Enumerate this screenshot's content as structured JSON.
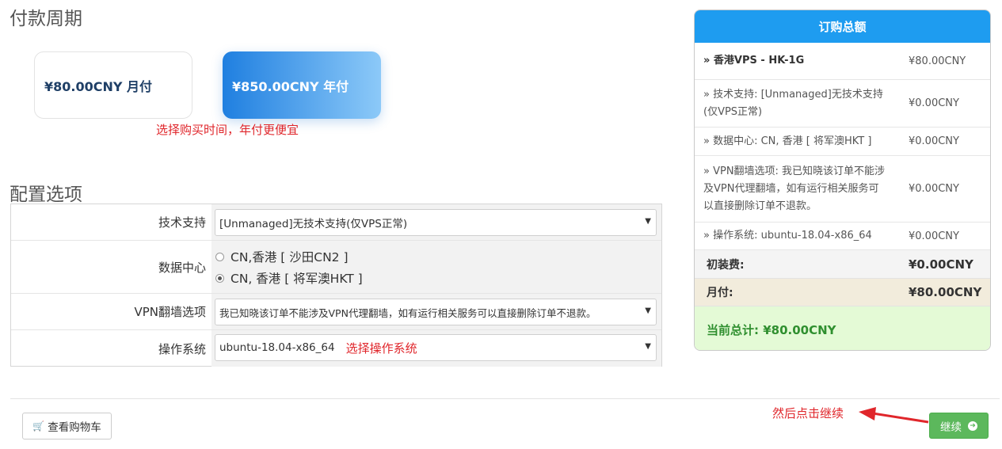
{
  "billing": {
    "title": "付款周期",
    "monthly_label": "¥80.00CNY 月付",
    "annual_label": "¥850.00CNY 年付",
    "annotation": "选择购买时间，年付更便宜"
  },
  "config": {
    "title": "配置选项",
    "support": {
      "label": "技术支持",
      "value": "[Unmanaged]无技术支持(仅VPS正常)"
    },
    "datacenter": {
      "label": "数据中心",
      "options": [
        "CN,香港 [ 沙田CN2 ]",
        "CN, 香港 [ 将军澳HKT ]"
      ],
      "selected_index": 1
    },
    "vpn": {
      "label": "VPN翻墙选项",
      "value": "我已知晓该订单不能涉及VPN代理翻墙，如有运行相关服务可以直接删除订单不退款。"
    },
    "os": {
      "label": "操作系统",
      "value": "ubuntu-18.04-x86_64",
      "annotation": "选择操作系统"
    }
  },
  "summary": {
    "header": "订购总额",
    "items": [
      {
        "desc": "» 香港VPS - HK-1G",
        "price": "¥80.00CNY"
      },
      {
        "desc": "» 技术支持: [Unmanaged]无技术支持(仅VPS正常)",
        "price": "¥0.00CNY"
      },
      {
        "desc": "» 数据中心: CN, 香港 [ 将军澳HKT ]",
        "price": "¥0.00CNY"
      },
      {
        "desc": "» VPN翻墙选项: 我已知晓该订单不能涉及VPN代理翻墙，如有运行相关服务可以直接删除订单不退款。",
        "price": "¥0.00CNY"
      },
      {
        "desc": "» 操作系统: ubuntu-18.04-x86_64",
        "price": "¥0.00CNY"
      }
    ],
    "setup_label": "初装费:",
    "setup_value": "¥0.00CNY",
    "monthly_label": "月付:",
    "monthly_value": "¥80.00CNY",
    "total": "当前总计: ¥80.00CNY"
  },
  "footer": {
    "cart_label": "查看购物车",
    "continue_label": "继续",
    "continue_annotation": "然后点击继续"
  },
  "colors": {
    "accent_blue": "#1e9cf0",
    "success_green": "#5cb85c",
    "annotation_red": "#e0262b"
  },
  "icons": {
    "cart": "shopping-cart-icon",
    "continue": "arrow-circle-right-icon",
    "select": "caret-down-icon"
  }
}
